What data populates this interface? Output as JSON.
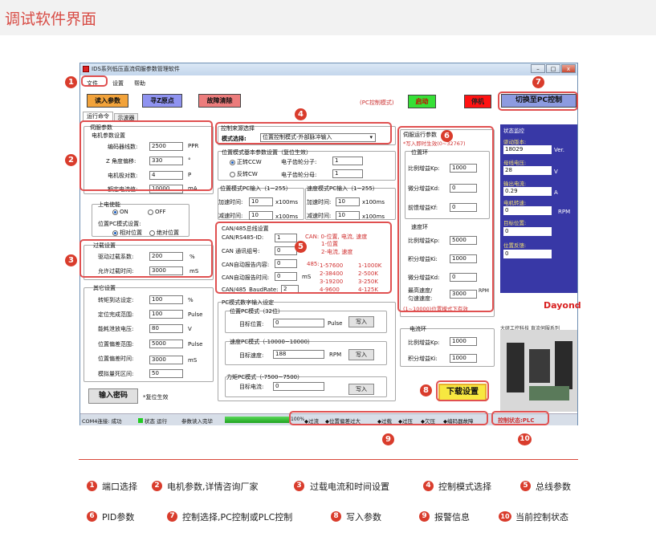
{
  "page_title": "调试软件界面",
  "window": {
    "title": "IDS系列低压直流伺服参数管理软件",
    "menu": [
      "文件",
      "设置",
      "帮助"
    ],
    "toolbar": {
      "read": "读入参数",
      "origin": "寻Z原点",
      "clear": "故障清除",
      "pc_mode": "(PC控制模式)",
      "start": "启动",
      "stop": "停机",
      "switch": "切换至PC控制"
    },
    "tabs": [
      "运行命令",
      "示波器"
    ],
    "motor": {
      "title": "伺服参数",
      "sub": "电机参数设置",
      "rows": [
        [
          "编码器线数:",
          "2500",
          "PPR"
        ],
        [
          "Z 角度偏移:",
          "330",
          "°"
        ],
        [
          "电机极对数:",
          "4",
          "P"
        ],
        [
          "额定电流值:",
          "10000",
          "mA"
        ]
      ]
    },
    "enable": {
      "title": "上电使能",
      "on": "ON",
      "off": "OFF",
      "pc_title": "位置PC模式设置:",
      "rel": "相对位置",
      "abs": "绝对位置"
    },
    "overload": {
      "title": "过载设置",
      "rows": [
        [
          "驱动过载系数:",
          "200",
          "%"
        ],
        [
          "允许过载时间:",
          "3000",
          "mS"
        ]
      ]
    },
    "other": {
      "title": "其它设置",
      "rows": [
        [
          "转矩到达设定:",
          "100",
          "%"
        ],
        [
          "定位完成范围:",
          "100",
          "Pulse"
        ],
        [
          "能耗泄放电压:",
          "80",
          "V"
        ],
        [
          "位置偏差范围:",
          "5000",
          "Pulse"
        ],
        [
          "位置偏差时间:",
          "3000",
          "mS"
        ],
        [
          "模拟量死区间:",
          "50",
          ""
        ]
      ]
    },
    "password": {
      "button": "输入密码",
      "note": "*复位生效"
    },
    "ctrl_src": {
      "title": "控制来源选择",
      "label": "模式选择:",
      "value": "位置控制模式-外部脉冲输入"
    },
    "pos_basic": {
      "title": "位置模式基本参数设置（复位生效）",
      "fwd": "正转CCW",
      "rev": "反转CW",
      "num_lbl": "电子齿轮分子:",
      "num_val": "1",
      "den_lbl": "电子齿轮分母:",
      "den_val": "1"
    },
    "pos_pc": {
      "title": "位置模式PC输入（1~255）",
      "acc": "加速时间:",
      "acc_v": "10",
      "dec": "减速时间:",
      "dec_v": "10",
      "unit": "x100ms"
    },
    "spd_pc": {
      "title": "速度模式PC输入（1~255）",
      "acc": "加速时间:",
      "acc_v": "10",
      "dec": "减速时间:",
      "dec_v": "10",
      "unit": "x100ms"
    },
    "can": {
      "title": "CAN/485总线设置",
      "rows": [
        [
          "CAN/RS485-ID:",
          "1",
          ""
        ],
        [
          "CAN 通讯组号:",
          "0",
          ""
        ],
        [
          "CAN自动报告内容:",
          "0",
          ""
        ],
        [
          "CAN自动报告时间:",
          "0",
          "mS"
        ],
        [
          "CAN/485_BaudRate:",
          "2",
          ""
        ]
      ],
      "note1": "CAN: 0-位置, 电流, 速度",
      "note2": "1-位置",
      "note3": "2-电流, 速度",
      "b485": "485:",
      "b1": "1-57600",
      "b2": "2-38400",
      "b3": "3-19200",
      "b4": "4-9600",
      "c1": "1-1000K",
      "c2": "2-500K",
      "c3": "3-250K",
      "c4": "4-125K"
    },
    "pc_num": {
      "title": "PC模式数字输入设定",
      "pos": {
        "title": "位置PC模式（32位）",
        "lbl": "目标位置:",
        "val": "0",
        "unit": "Pulse",
        "btn": "写入"
      },
      "spd": {
        "title": "速度PC模式（-10000~10000）",
        "lbl": "目标速度:",
        "val": "188",
        "unit": "RPM",
        "btn": "写入"
      },
      "trq": {
        "title": "力矩PC模式（-7500~7500）",
        "lbl": "目标电流:",
        "val": "0",
        "btn": "写入"
      }
    },
    "pid": {
      "title": "伺服运行参数",
      "note": "*写入即时生效(0~32767)",
      "pos_ring": "位置环",
      "kp": "比例增益Kp:",
      "kp_v": "1000",
      "kd": "微分增益Kd:",
      "kd_v": "0",
      "kf": "前馈增益Kf:",
      "kf_v": "0",
      "spd_ring": "速度环",
      "skp": "比例增益Kp:",
      "skp_v": "5000",
      "ski": "积分增益Ki:",
      "ski_v": "1000",
      "skd": "微分增益Kd:",
      "skd_v": "0",
      "max": "最高速度/",
      "max2": "匀速速度:",
      "max_v": "3000",
      "max_u": "RPM",
      "note2": "(1~10000)位置模式下有效",
      "cur_ring": "电流环",
      "ckp": "比例增益Kp:",
      "ckp_v": "1000",
      "cki": "积分增益Ki:",
      "cki_v": "1000"
    },
    "download": "下载设置",
    "monitor": {
      "title": "状态监控",
      "drv": "驱动版本:",
      "drv_v": "18029",
      "drv_u": "Ver.",
      "volt": "母线电压:",
      "volt_v": "28",
      "volt_u": "V",
      "cur": "输出电流:",
      "cur_v": "0.29",
      "cur_u": "A",
      "spd": "电机转速:",
      "spd_v": "0",
      "spd_u": "RPM",
      "pos": "目标位置:",
      "pos_v": "0",
      "fb": "位置反馈:",
      "fb_v": "0"
    },
    "brand": "Dayond",
    "brand_sub": "大研工控科技 直流伺服系列",
    "status": {
      "com": "COM4连接: 成功",
      "state": "状态 运行",
      "read": "参数读入完毕",
      "pct": "100%",
      "alarms": [
        "过流",
        "位置偏差过大",
        "过载",
        "过压",
        "欠压",
        "编码器故障"
      ],
      "ctrl": "控制状态:PLC"
    }
  },
  "legend": [
    [
      "1",
      "端口选择"
    ],
    [
      "2",
      "电机参数,详情咨询厂家"
    ],
    [
      "3",
      "过载电流和时间设置"
    ],
    [
      "4",
      "控制模式选择"
    ],
    [
      "5",
      "总线参数"
    ],
    [
      "6",
      "PID参数"
    ],
    [
      "7",
      "控制选择,PC控制或PLC控制"
    ],
    [
      "8",
      "写入参数"
    ],
    [
      "9",
      "报警信息"
    ],
    [
      "10",
      "当前控制状态"
    ]
  ],
  "colors": {
    "accent": "#d93c2c",
    "monitor_bg": "#3838a6"
  }
}
